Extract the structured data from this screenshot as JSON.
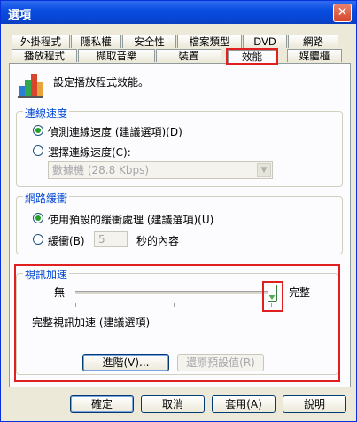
{
  "window": {
    "title": "選項",
    "close_glyph": "✕"
  },
  "tabs_back": [
    "外掛程式",
    "隱私權",
    "安全性",
    "檔案類型",
    "DVD",
    "網路"
  ],
  "tabs_front": [
    "播放程式",
    "擷取音樂",
    "裝置",
    "效能",
    "媒體櫃"
  ],
  "active_tab": "效能",
  "header": {
    "text": "設定播放程式效能。"
  },
  "connection": {
    "legend": "連線速度",
    "detect_label": "偵測連線速度 (建議選項)(D)",
    "choose_label": "選擇連線速度(C):",
    "combo_value": "數據機 (28.8 Kbps)"
  },
  "buffer": {
    "legend": "網路緩衝",
    "default_label": "使用預設的緩衝處理 (建議選項)(U)",
    "buffer_label": "緩衝(B)",
    "buffer_value": "5",
    "seconds_label": "秒的內容"
  },
  "video": {
    "legend": "視訊加速",
    "min_label": "無",
    "max_label": "完整",
    "slider_level": 1.0,
    "description": "完整視訊加速 (建議選項)",
    "advanced_button": "進階(V)...",
    "restore_button": "還原預設值(R)"
  },
  "footer": {
    "ok": "確定",
    "cancel": "取消",
    "apply": "套用(A)",
    "help": "說明"
  },
  "colors": {
    "highlight": "#e02020",
    "accent": "#0046d5"
  }
}
